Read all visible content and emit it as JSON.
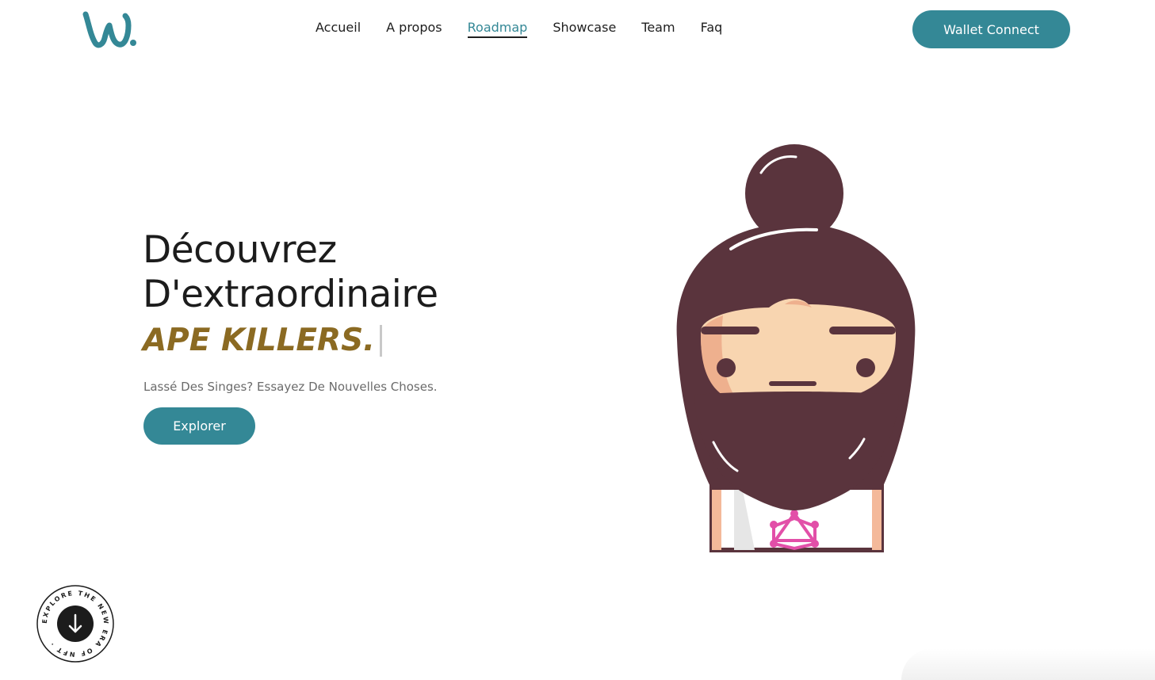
{
  "brand": {
    "logo_text": "w.",
    "logo_color": "#348896"
  },
  "nav": {
    "items": [
      {
        "label": "Accueil"
      },
      {
        "label": "A propos"
      },
      {
        "label": "Roadmap",
        "active": true
      },
      {
        "label": "Showcase"
      },
      {
        "label": "Team"
      },
      {
        "label": "Faq"
      }
    ]
  },
  "header": {
    "wallet_label": "Wallet Connect"
  },
  "hero": {
    "title_line1": "Découvrez",
    "title_line2": "D'extraordinaire",
    "accent": "APE KILLERS.",
    "subtitle": "Lassé Des Singes? Essayez De Nouvelles Choses.",
    "cta_label": "Explorer"
  },
  "badge": {
    "circular_text": "EXPLORE THE NEW ERA OF NFT ·",
    "icon": "arrow-down-icon"
  },
  "colors": {
    "accent": "#348896",
    "gold": "#8b6a22",
    "hair": "#5a343d",
    "skin": "#f8d5b0",
    "pink": "#e24fa8"
  }
}
